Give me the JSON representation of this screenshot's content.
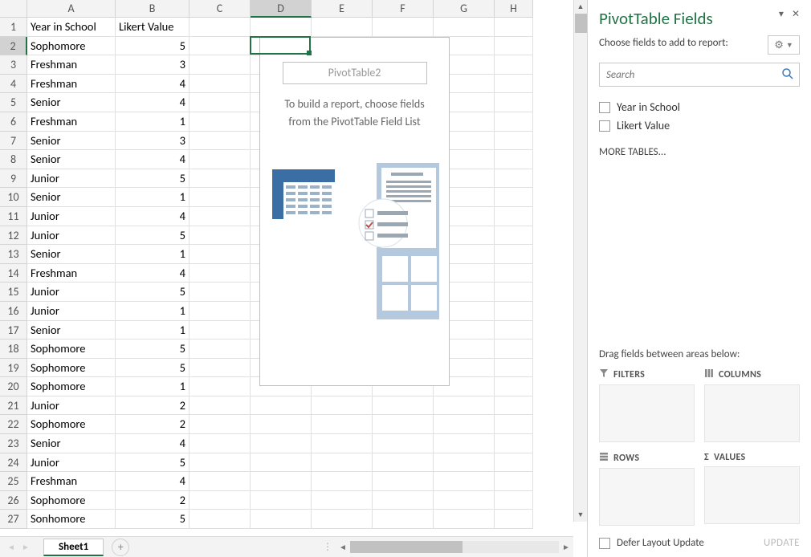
{
  "columns": [
    "A",
    "B",
    "C",
    "D",
    "E",
    "F",
    "G",
    "H"
  ],
  "selected_col": "D",
  "selected_row": 2,
  "headers": {
    "A": "Year in School",
    "B": "Likert Value"
  },
  "data": [
    {
      "A": "Sophomore",
      "B": 5
    },
    {
      "A": "Freshman",
      "B": 3
    },
    {
      "A": "Freshman",
      "B": 4
    },
    {
      "A": "Senior",
      "B": 4
    },
    {
      "A": "Freshman",
      "B": 1
    },
    {
      "A": "Senior",
      "B": 3
    },
    {
      "A": "Senior",
      "B": 4
    },
    {
      "A": "Junior",
      "B": 5
    },
    {
      "A": "Senior",
      "B": 1
    },
    {
      "A": "Junior",
      "B": 4
    },
    {
      "A": "Junior",
      "B": 5
    },
    {
      "A": "Senior",
      "B": 1
    },
    {
      "A": "Freshman",
      "B": 4
    },
    {
      "A": "Junior",
      "B": 5
    },
    {
      "A": "Junior",
      "B": 1
    },
    {
      "A": "Senior",
      "B": 1
    },
    {
      "A": "Sophomore",
      "B": 5
    },
    {
      "A": "Sophomore",
      "B": 5
    },
    {
      "A": "Sophomore",
      "B": 1
    },
    {
      "A": "Junior",
      "B": 2
    },
    {
      "A": "Sophomore",
      "B": 2
    },
    {
      "A": "Senior",
      "B": 4
    },
    {
      "A": "Junior",
      "B": 5
    },
    {
      "A": "Freshman",
      "B": 4
    },
    {
      "A": "Sophomore",
      "B": 2
    },
    {
      "A": "Sonhomore",
      "B": 5
    }
  ],
  "pivot": {
    "placeholder_name": "PivotTable2",
    "instr1": "To build a report, choose fields",
    "instr2": "from the PivotTable Field List"
  },
  "sheet_tab": "Sheet1",
  "panel": {
    "title": "PivotTable Fields",
    "subtitle": "Choose fields to add to report:",
    "search_placeholder": "Search",
    "fields": [
      "Year in School",
      "Likert Value"
    ],
    "more_tables": "MORE TABLES...",
    "drag_label": "Drag fields between areas below:",
    "areas": {
      "filters": "FILTERS",
      "columns": "COLUMNS",
      "rows": "ROWS",
      "values": "VALUES"
    },
    "defer_label": "Defer Layout Update",
    "update_btn": "UPDATE"
  }
}
